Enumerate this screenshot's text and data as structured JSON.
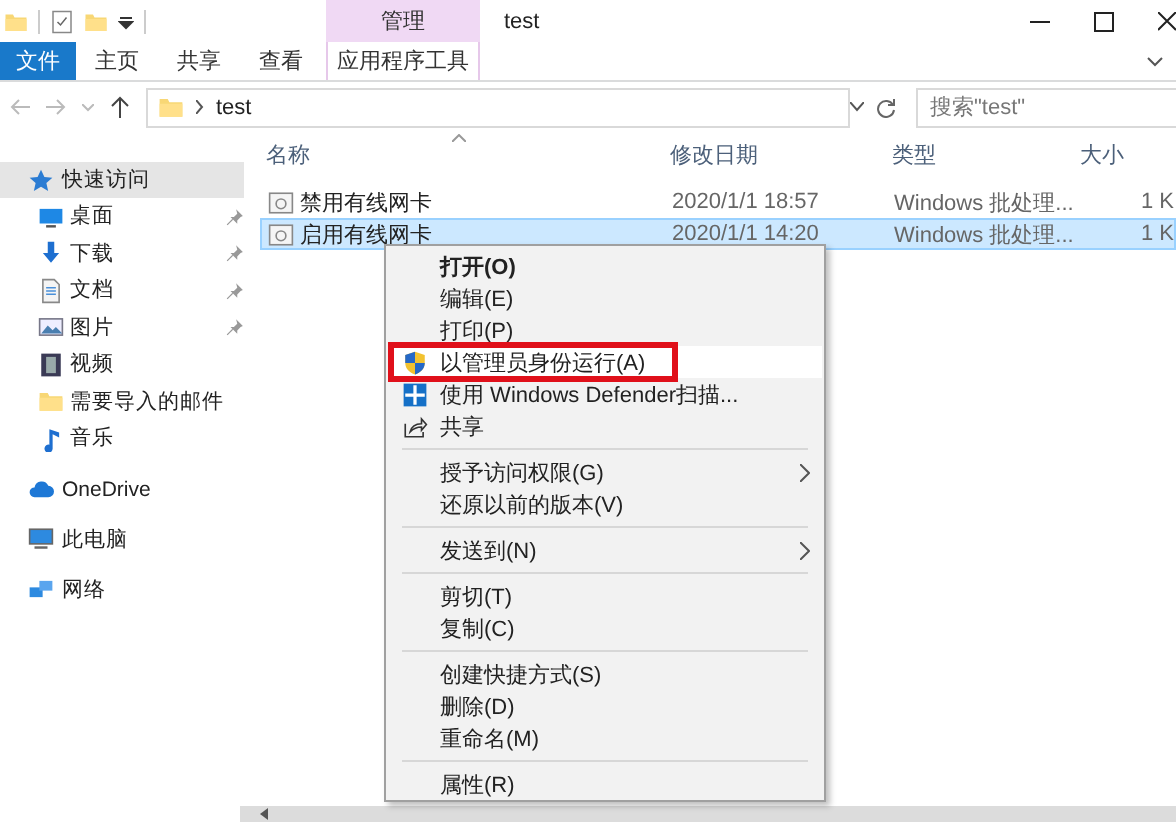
{
  "title_bar": {
    "context_tab": "管理",
    "title": "test"
  },
  "ribbon_tabs": [
    {
      "label": "文件",
      "kind": "file",
      "selected": false
    },
    {
      "label": "主页",
      "kind": "normal",
      "selected": false
    },
    {
      "label": "共享",
      "kind": "normal",
      "selected": false
    },
    {
      "label": "查看",
      "kind": "normal",
      "selected": false
    },
    {
      "label": "应用程序工具",
      "kind": "context",
      "selected": false
    }
  ],
  "address_bar": {
    "path": "test",
    "search_placeholder": "搜索\"test\""
  },
  "nav_pane": [
    {
      "label": "快速访问",
      "kind": "star",
      "selected": true,
      "children": [
        {
          "label": "桌面",
          "kind": "desktop",
          "pinned": true,
          "selected": false
        },
        {
          "label": "下载",
          "kind": "download",
          "pinned": true,
          "selected": false
        },
        {
          "label": "文档",
          "kind": "document",
          "pinned": true,
          "selected": false
        },
        {
          "label": "图片",
          "kind": "picture",
          "pinned": true,
          "selected": false
        },
        {
          "label": "视频",
          "kind": "video",
          "pinned": false,
          "selected": false
        },
        {
          "label": "需要导入的邮件",
          "kind": "folder",
          "pinned": false,
          "selected": false
        },
        {
          "label": "音乐",
          "kind": "music",
          "pinned": false,
          "selected": false
        }
      ]
    },
    {
      "label": "OneDrive",
      "kind": "cloud",
      "selected": false
    },
    {
      "label": "此电脑",
      "kind": "computer",
      "selected": false
    },
    {
      "label": "网络",
      "kind": "network",
      "selected": false
    }
  ],
  "file_list": {
    "columns": [
      {
        "label": "名称",
        "sorted": true
      },
      {
        "label": "修改日期",
        "sorted": false
      },
      {
        "label": "类型",
        "sorted": false
      },
      {
        "label": "大小",
        "sorted": false
      }
    ],
    "rows": [
      {
        "name": "禁用有线网卡",
        "modified": "2020/1/1 18:57",
        "type": "Windows 批处理...",
        "size": "1 K",
        "selected": false
      },
      {
        "name": "启用有线网卡",
        "modified": "2020/1/1 14:20",
        "type": "Windows 批处理...",
        "size": "1 K",
        "selected": true
      }
    ]
  },
  "context_menu": [
    {
      "kind": "item",
      "label": "打开(O)",
      "bold": true
    },
    {
      "kind": "item",
      "label": "编辑(E)"
    },
    {
      "kind": "item",
      "label": "打印(P)"
    },
    {
      "kind": "item",
      "label": "以管理员身份运行(A)",
      "highlighted": true,
      "hovered": true
    },
    {
      "kind": "item",
      "label": "使用 Windows Defender扫描..."
    },
    {
      "kind": "item",
      "label": "共享"
    },
    {
      "kind": "separator"
    },
    {
      "kind": "item",
      "label": "授予访问权限(G)",
      "submenu": true
    },
    {
      "kind": "item",
      "label": "还原以前的版本(V)"
    },
    {
      "kind": "separator"
    },
    {
      "kind": "item",
      "label": "发送到(N)",
      "submenu": true
    },
    {
      "kind": "separator"
    },
    {
      "kind": "item",
      "label": "剪切(T)"
    },
    {
      "kind": "item",
      "label": "复制(C)"
    },
    {
      "kind": "separator"
    },
    {
      "kind": "item",
      "label": "创建快捷方式(S)"
    },
    {
      "kind": "item",
      "label": "删除(D)"
    },
    {
      "kind": "item",
      "label": "重命名(M)"
    },
    {
      "kind": "separator"
    },
    {
      "kind": "item",
      "label": "属性(R)"
    }
  ]
}
